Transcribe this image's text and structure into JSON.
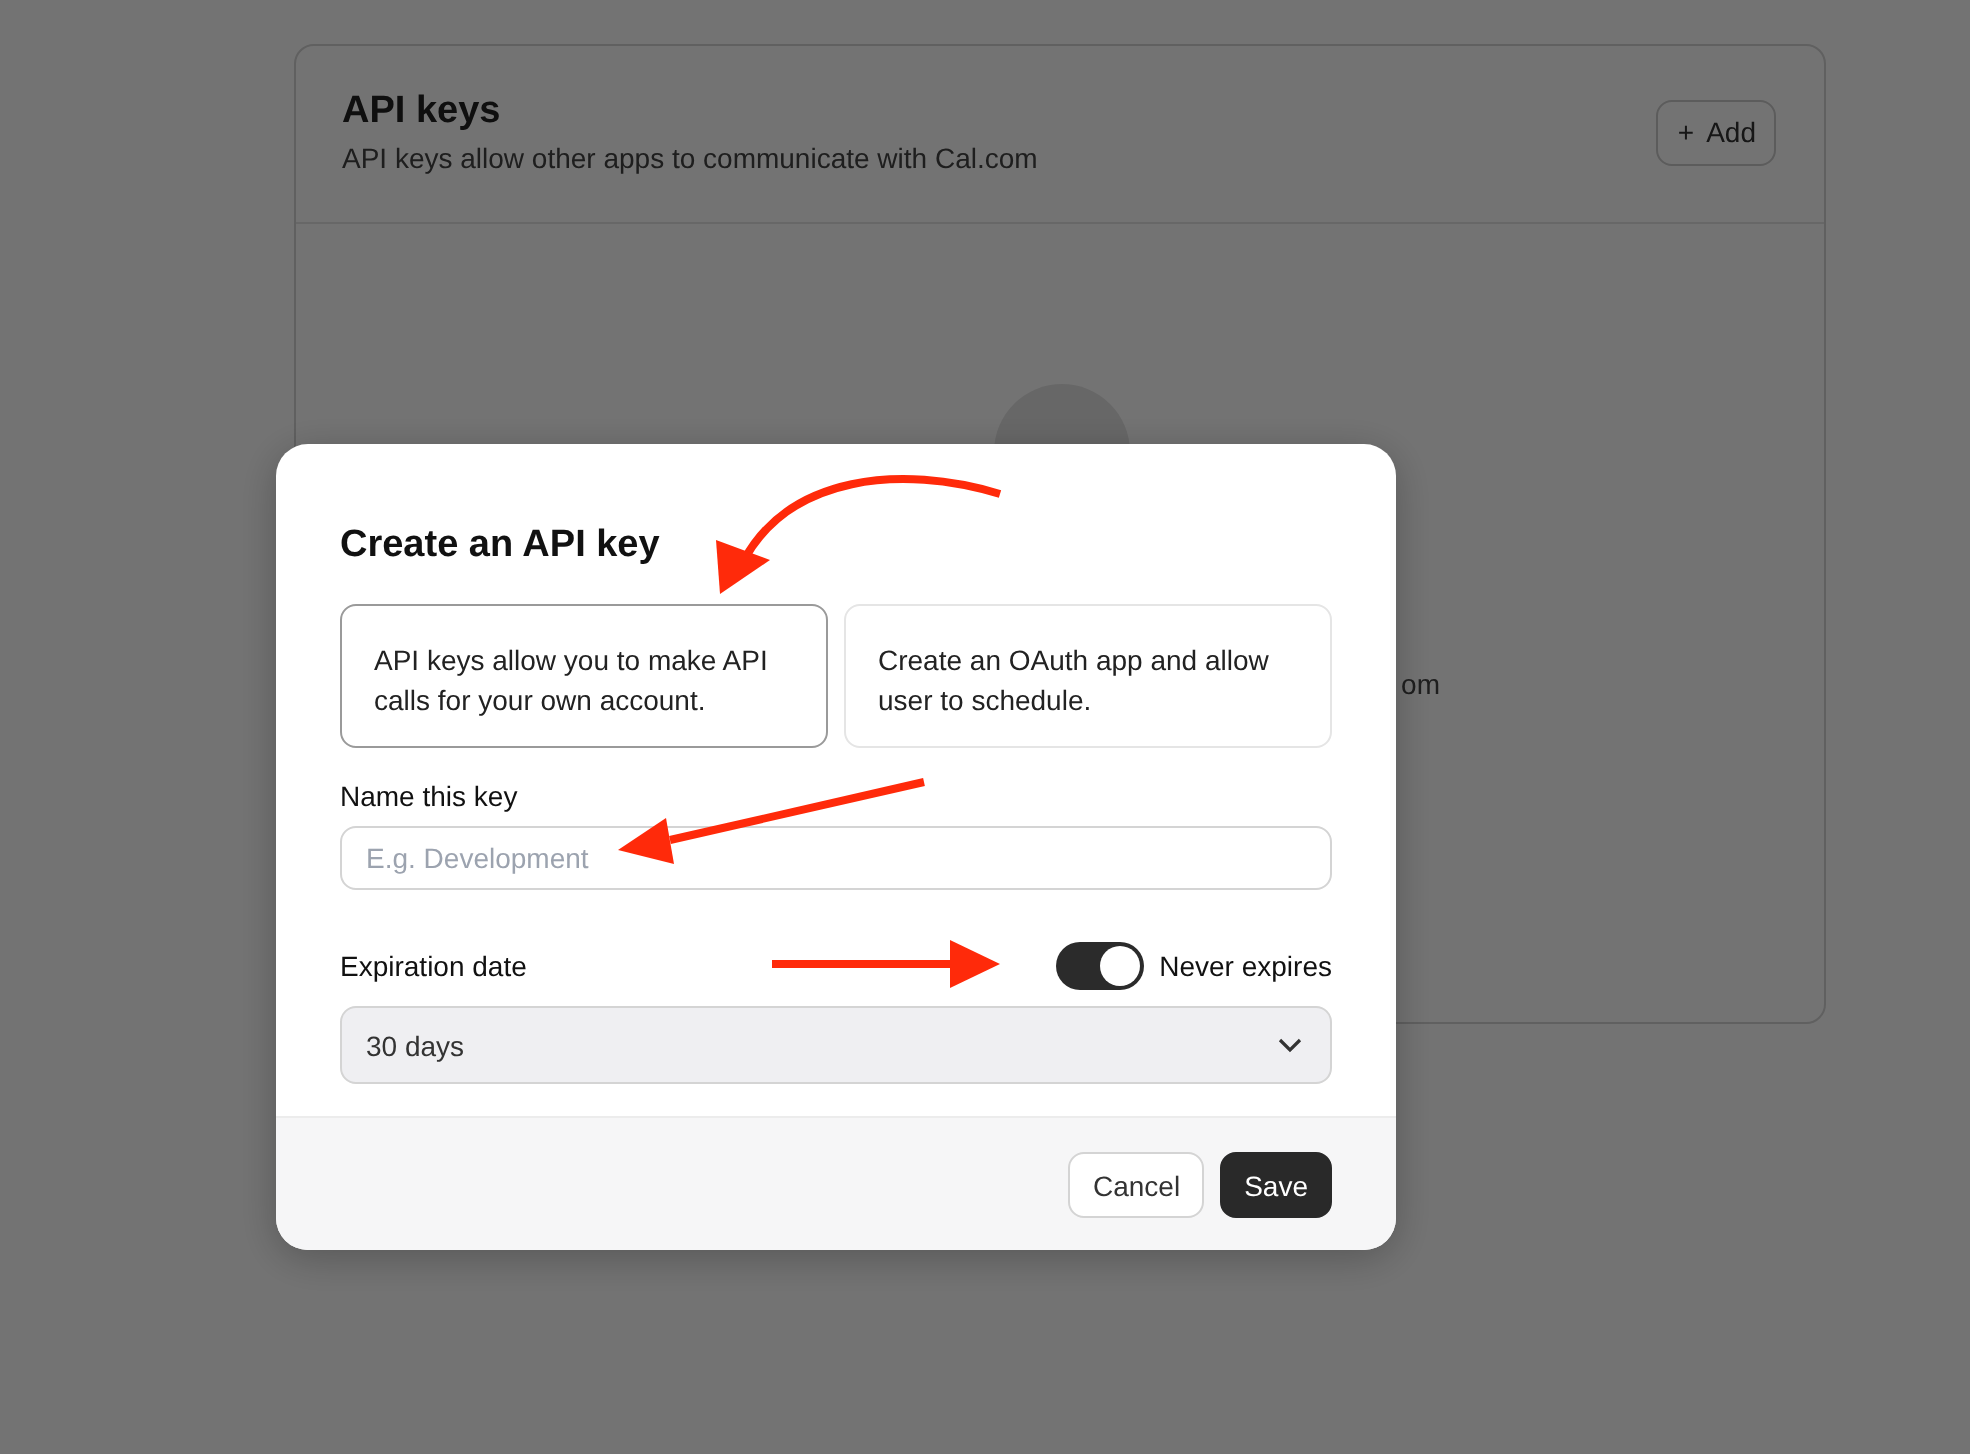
{
  "page": {
    "title": "API keys",
    "subtitle": "API keys allow other apps to communicate with Cal.com",
    "add_button": {
      "icon": "+",
      "label": "Add"
    },
    "empty_state_fragment": "om"
  },
  "dialog": {
    "title": "Create an API key",
    "options": [
      {
        "text": "API keys allow you to make API calls for your own account.",
        "selected": true
      },
      {
        "text": "Create an OAuth app and allow user to schedule.",
        "selected": false
      }
    ],
    "name_field": {
      "label": "Name this key",
      "placeholder": "E.g. Development"
    },
    "expiration": {
      "label": "Expiration date",
      "never_expires": true,
      "toggle_label": "Never expires",
      "select_value": "30 days"
    },
    "buttons": [
      {
        "label": "Cancel",
        "kind": "secondary"
      },
      {
        "label": "Save",
        "kind": "primary"
      }
    ]
  }
}
